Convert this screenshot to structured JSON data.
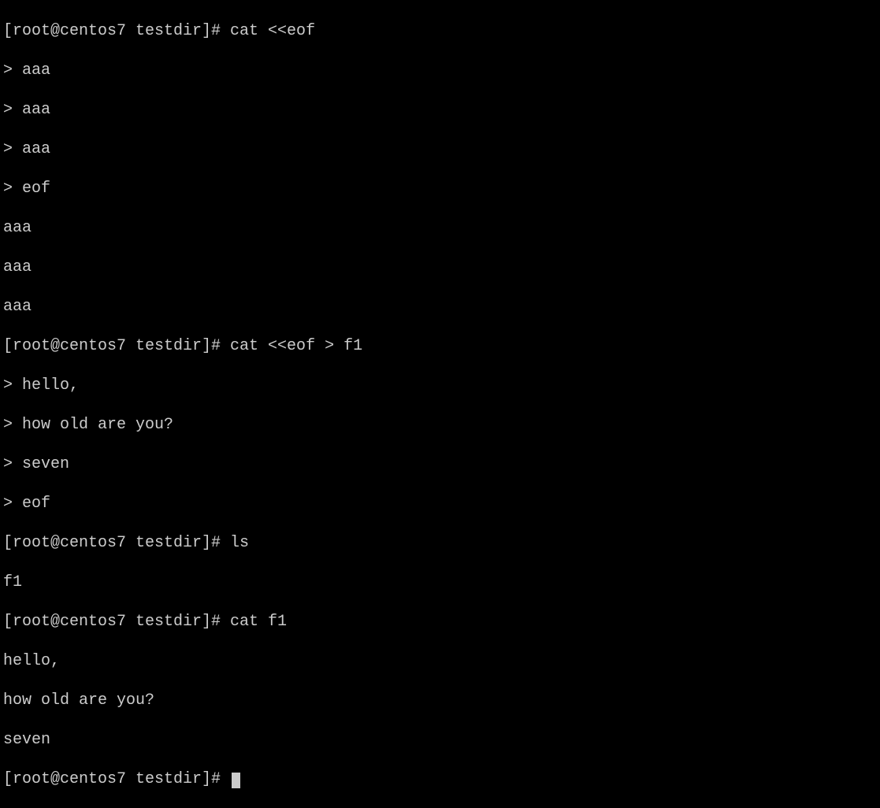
{
  "terminal": {
    "lines": [
      "[root@centos7 testdir]# cat <<eof",
      "> aaa",
      "> aaa",
      "> aaa",
      "> eof",
      "aaa",
      "aaa",
      "aaa",
      "[root@centos7 testdir]# cat <<eof > f1",
      "> hello,",
      "> how old are you?",
      "> seven",
      "> eof",
      "[root@centos7 testdir]# ls",
      "f1",
      "[root@centos7 testdir]# cat f1",
      "hello,",
      "how old are you?",
      "seven"
    ],
    "prompt": "[root@centos7 testdir]# "
  }
}
